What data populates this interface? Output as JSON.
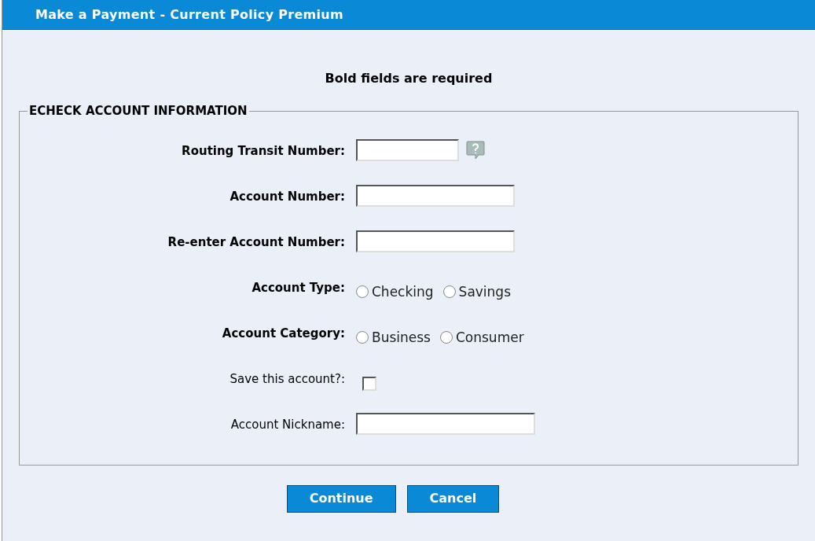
{
  "window": {
    "title": "Make a Payment -  Current Policy Premium"
  },
  "notice": "Bold fields are required",
  "fieldset": {
    "legend": "ECHECK ACCOUNT INFORMATION",
    "rows": [
      {
        "kind": "text",
        "label": "Routing Transit Number:",
        "required": true,
        "help": true
      },
      {
        "kind": "text",
        "label": "Account Number:",
        "required": true,
        "help": false
      },
      {
        "kind": "text",
        "label": "Re-enter Account Number:",
        "required": true,
        "help": false
      },
      {
        "kind": "radio",
        "label": "Account Type:",
        "required": true,
        "options": [
          {
            "label": "Checking",
            "selected": false
          },
          {
            "label": "Savings",
            "selected": false
          }
        ]
      },
      {
        "kind": "radio",
        "label": "Account Category:",
        "required": true,
        "options": [
          {
            "label": "Business",
            "selected": false
          },
          {
            "label": "Consumer",
            "selected": false
          }
        ]
      },
      {
        "kind": "checkbox",
        "label": "Save this account?:",
        "required": false,
        "checked": false
      },
      {
        "kind": "text",
        "label": "Account Nickname:",
        "required": false,
        "help": false
      }
    ]
  },
  "buttons": [
    "Continue",
    "Cancel"
  ]
}
